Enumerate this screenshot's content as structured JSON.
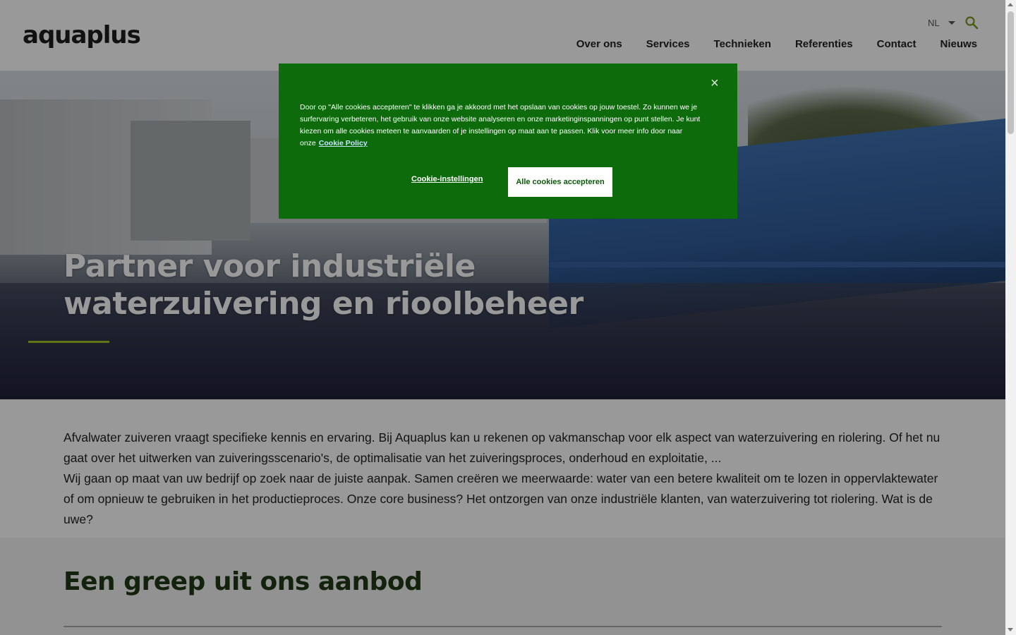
{
  "header": {
    "logo": "aquaplus",
    "language": "NL",
    "nav": [
      "Over ons",
      "Services",
      "Technieken",
      "Referenties",
      "Contact",
      "Nieuws"
    ]
  },
  "hero": {
    "title_line1": "Partner voor industriële",
    "title_line2": "waterzuivering en rioolbeheer"
  },
  "intro": {
    "paragraph1": "Afvalwater zuiveren vraagt specifieke kennis en ervaring. Bij Aquaplus kan u rekenen op vakmanschap voor elk aspect van waterzuivering en riolering. Of het nu gaat over het uitwerken van zuiveringsscenario's, de optimalisatie van het zuiveringsproces, onderhoud en exploitatie, ...",
    "paragraph2": "Wij gaan op maat van uw bedrijf op zoek naar de juiste aanpak. Samen creëren we meerwaarde: water van een betere kwaliteit om te lozen in oppervlaktewater of om opnieuw te gebruiken in het productieproces. Onze core business? Het ontzorgen van onze industriële klanten, van waterzuivering tot riolering. Wat is de uwe?"
  },
  "offer": {
    "heading": "Een greep uit ons aanbod"
  },
  "cookie_banner": {
    "text": "Door op \"Alle cookies accepteren\" te klikken ga je akkoord met het opslaan van cookies op jouw toestel. Zo kunnen we je surfervaring verbeteren, het gebruik van onze website analyseren en onze marketinginspanningen op punt stellen. Je kunt kiezen om alle cookies meteen te aanvaarden of je instellingen op maat aan te passen. Klik voor meer info door naar onze",
    "policy_link": "Cookie Policy",
    "settings_label": "Cookie-instellingen",
    "accept_label": "Alle cookies accepteren",
    "close_symbol": "×"
  },
  "colors": {
    "accent_green": "#9bc227",
    "cookie_bg": "#0d6b0c",
    "heading_dark_green": "#1f3a14"
  }
}
